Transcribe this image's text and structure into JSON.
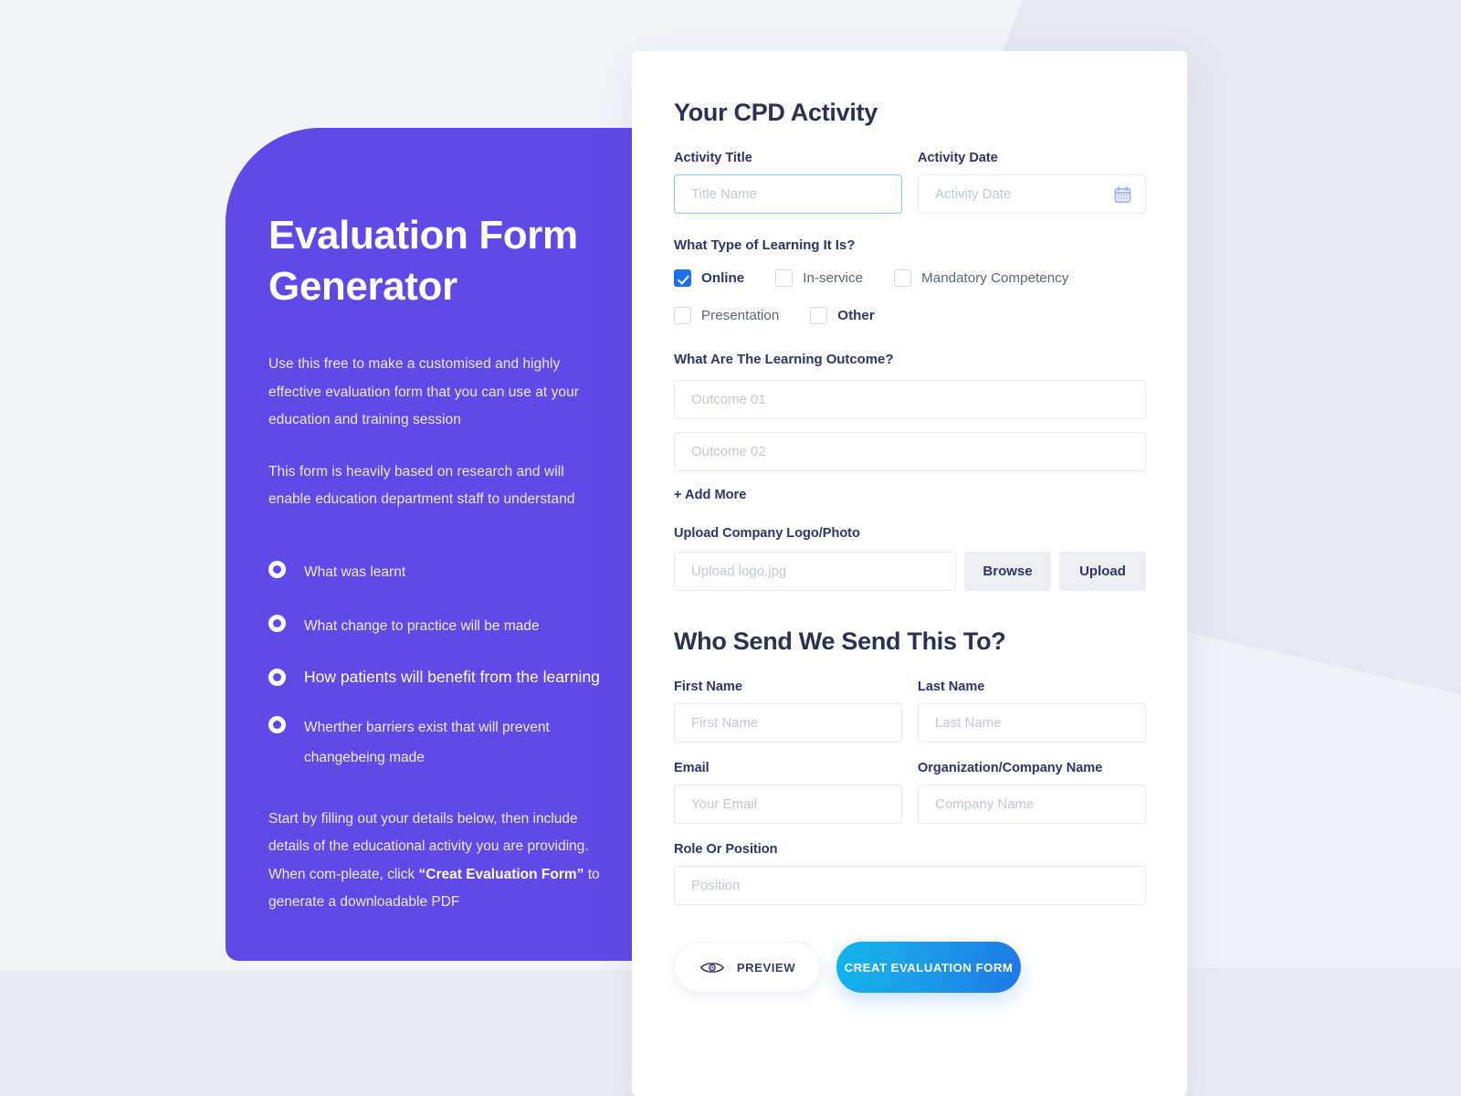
{
  "theme": {
    "purple": "#6049e6",
    "accent_blue": "#1f6fee",
    "gradient_from": "#11b4ea",
    "gradient_to": "#1f78e6",
    "page_background": "#f2f4f8",
    "heading_navy": "#2e3050"
  },
  "hero": {
    "title": "Evaluation Form\nGenerator",
    "paragraph_1": "Use this free to make a customised and highly effective evaluation form that you can use at  your education and training session",
    "paragraph_2": "This form is heavily based on research and will enable education department staff to understand",
    "bullets": [
      {
        "label": "What was learnt",
        "emphasis": false
      },
      {
        "label": "What change to practice will be made",
        "emphasis": false
      },
      {
        "label": "How patients will benefit from the learning",
        "emphasis": true
      },
      {
        "label": "Wherther barriers exist that will prevent changebeing made",
        "emphasis": false
      }
    ],
    "footnote_part_1": "Start by filling out your details below, then include details of the educational activity you are providing. When com-pleate, click ",
    "footnote_bold": "“Creat Evaluation Form”",
    "footnote_part_2": " to generate a downloadable PDF"
  },
  "form": {
    "activity_section": {
      "title": "Your CPD Activity",
      "activity_title": {
        "label": "Activity Title",
        "placeholder": "Title Name",
        "value": ""
      },
      "activity_date": {
        "label": "Activity Date",
        "placeholder": "Activity Date",
        "value": "",
        "icon": "calendar-icon"
      },
      "learning_type": {
        "question": "What Type of Learning It Is?",
        "options": [
          {
            "label": "Online",
            "checked": true,
            "strong": true
          },
          {
            "label": "In-service",
            "checked": false,
            "strong": false
          },
          {
            "label": "Mandatory Competency",
            "checked": false,
            "strong": false
          },
          {
            "label": "Presentation",
            "checked": false,
            "strong": false
          },
          {
            "label": "Other",
            "checked": false,
            "strong": true
          }
        ]
      },
      "learning_outcome": {
        "question": "What Are The Learning Outcome?",
        "fields": [
          {
            "placeholder": "Outcome 01",
            "value": ""
          },
          {
            "placeholder": "Outcome 02",
            "value": ""
          }
        ],
        "add_more_label": "+ Add More"
      },
      "upload": {
        "label": "Upload Company Logo/Photo",
        "placeholder": "Upload logo.jpg",
        "value": "",
        "browse_label": "Browse",
        "upload_label": "Upload"
      }
    },
    "recipient_section": {
      "title": "Who Send We Send This To?",
      "first_name": {
        "label": "First Name",
        "placeholder": "First Name",
        "value": ""
      },
      "last_name": {
        "label": "Last Name",
        "placeholder": "Last Name",
        "value": ""
      },
      "email": {
        "label": "Email",
        "placeholder": "Your Email",
        "value": ""
      },
      "organization": {
        "label": "Organization/Company Name",
        "placeholder": "Company Name",
        "value": ""
      },
      "role": {
        "label": "Role Or Position",
        "placeholder": "Position",
        "value": ""
      }
    },
    "actions": {
      "preview_label": "PREVIEW",
      "preview_icon": "eye-icon",
      "create_label": "CREAT EVALUATION FORM"
    }
  }
}
